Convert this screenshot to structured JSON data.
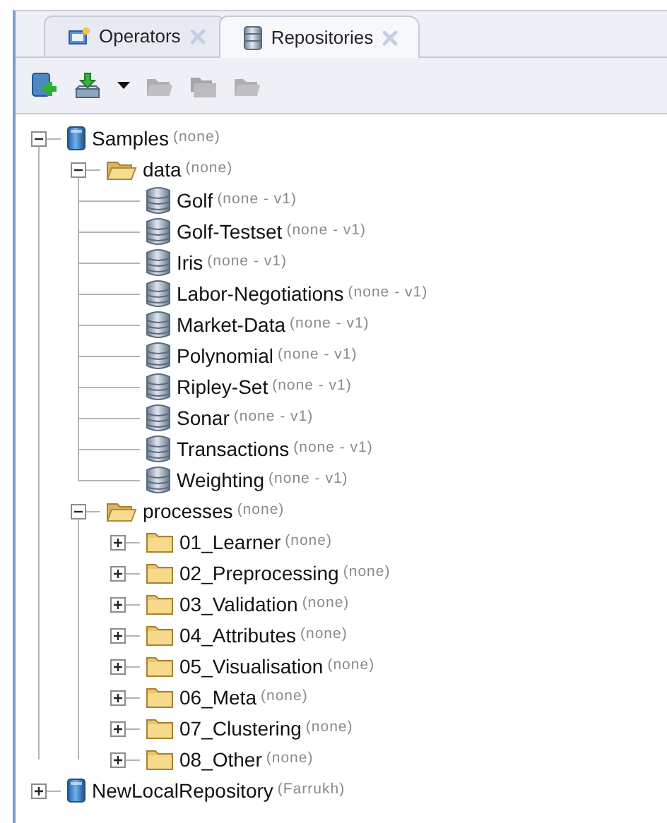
{
  "tabs": [
    {
      "label": "Operators",
      "selected": false,
      "kind": "operators"
    },
    {
      "label": "Repositories",
      "selected": true,
      "kind": "repository"
    }
  ],
  "toolbar": [
    {
      "kind": "add-repository",
      "disabled": false
    },
    {
      "kind": "import",
      "disabled": false,
      "dropdown": true
    },
    {
      "kind": "folder",
      "disabled": true
    },
    {
      "kind": "folders",
      "disabled": true
    },
    {
      "kind": "folder",
      "disabled": true
    }
  ],
  "tree": [
    {
      "kind": "repository",
      "name": "Samples",
      "status": "(none)",
      "expanded": true,
      "children": [
        {
          "kind": "folder",
          "name": "data",
          "status": "(none)",
          "expanded": true,
          "children": [
            {
              "kind": "dataset",
              "name": "Golf",
              "status": "(none - v1)"
            },
            {
              "kind": "dataset",
              "name": "Golf-Testset",
              "status": "(none - v1)"
            },
            {
              "kind": "dataset",
              "name": "Iris",
              "status": "(none - v1)"
            },
            {
              "kind": "dataset",
              "name": "Labor-Negotiations",
              "status": "(none - v1)"
            },
            {
              "kind": "dataset",
              "name": "Market-Data",
              "status": "(none - v1)"
            },
            {
              "kind": "dataset",
              "name": "Polynomial",
              "status": "(none - v1)"
            },
            {
              "kind": "dataset",
              "name": "Ripley-Set",
              "status": "(none - v1)"
            },
            {
              "kind": "dataset",
              "name": "Sonar",
              "status": "(none - v1)"
            },
            {
              "kind": "dataset",
              "name": "Transactions",
              "status": "(none - v1)"
            },
            {
              "kind": "dataset",
              "name": "Weighting",
              "status": "(none - v1)"
            }
          ]
        },
        {
          "kind": "folder",
          "name": "processes",
          "status": "(none)",
          "expanded": true,
          "children": [
            {
              "kind": "folder",
              "name": "01_Learner",
              "status": "(none)",
              "expanded": false
            },
            {
              "kind": "folder",
              "name": "02_Preprocessing",
              "status": "(none)",
              "expanded": false
            },
            {
              "kind": "folder",
              "name": "03_Validation",
              "status": "(none)",
              "expanded": false
            },
            {
              "kind": "folder",
              "name": "04_Attributes",
              "status": "(none)",
              "expanded": false
            },
            {
              "kind": "folder",
              "name": "05_Visualisation",
              "status": "(none)",
              "expanded": false
            },
            {
              "kind": "folder",
              "name": "06_Meta",
              "status": "(none)",
              "expanded": false
            },
            {
              "kind": "folder",
              "name": "07_Clustering",
              "status": "(none)",
              "expanded": false
            },
            {
              "kind": "folder",
              "name": "08_Other",
              "status": "(none)",
              "expanded": false
            }
          ]
        }
      ]
    },
    {
      "kind": "repository",
      "name": "NewLocalRepository",
      "status": "(Farrukh)",
      "expanded": false
    }
  ]
}
